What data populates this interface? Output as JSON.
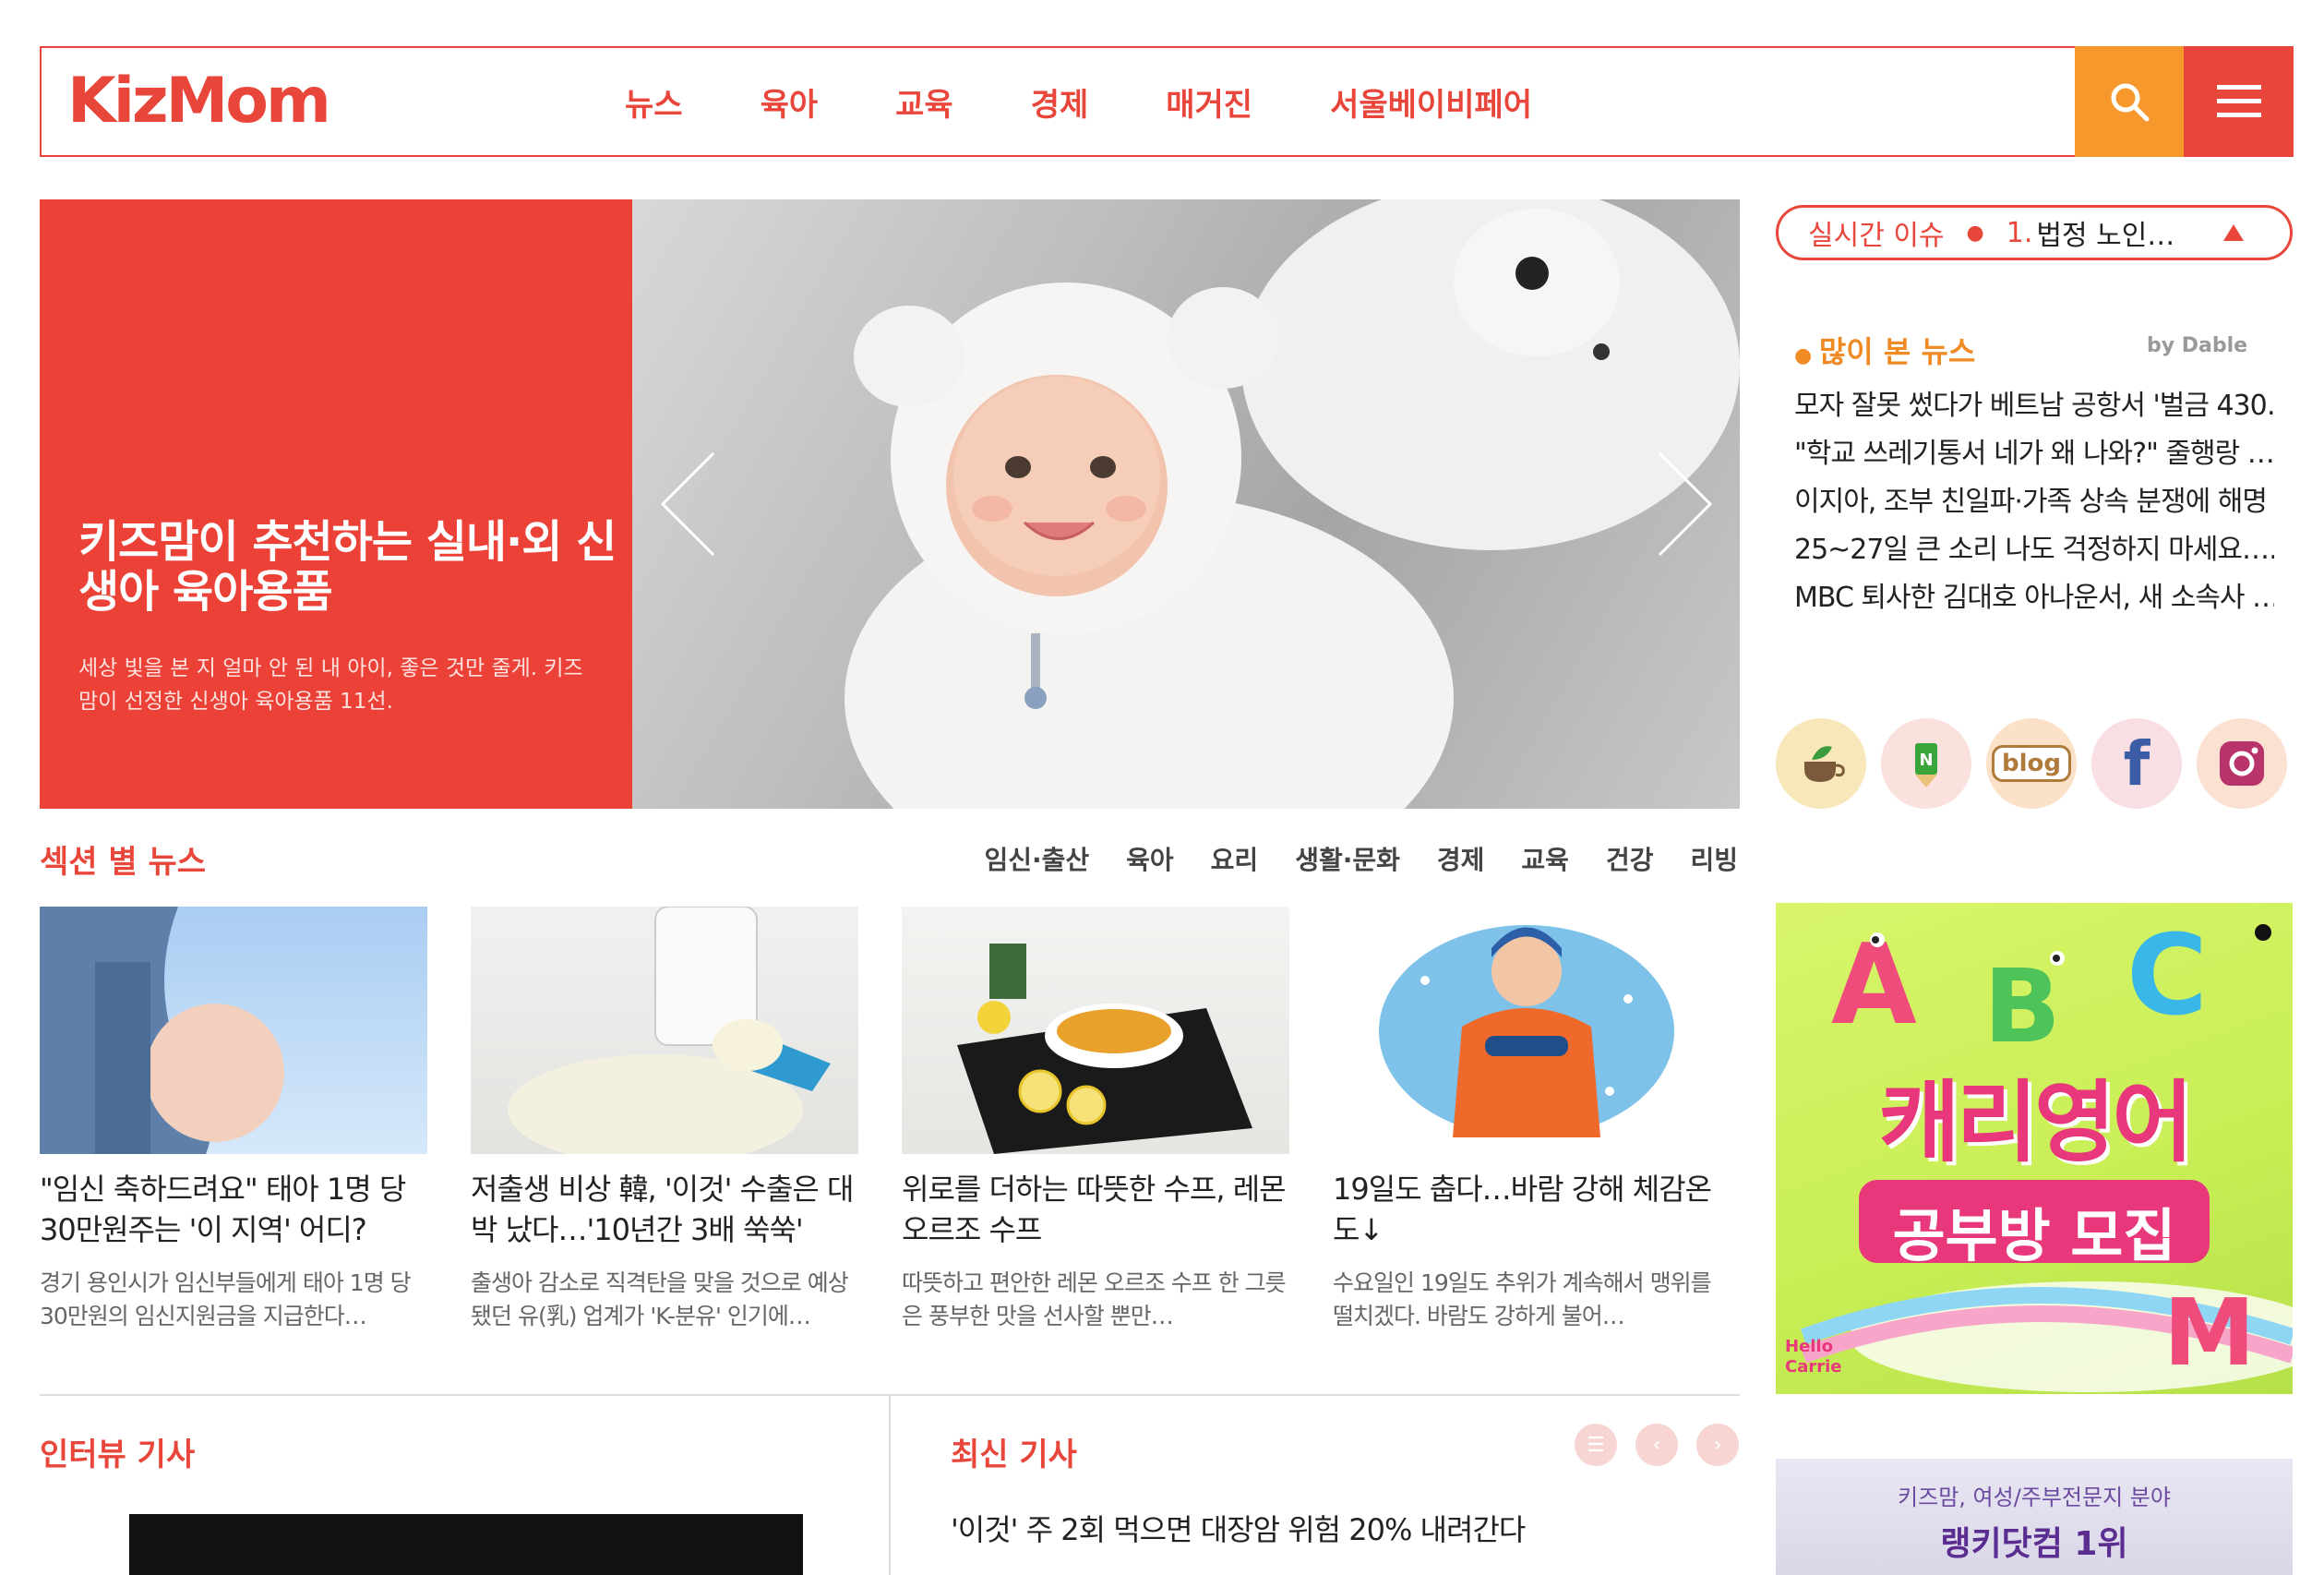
{
  "header": {
    "logo": "KizMom",
    "nav": [
      "뉴스",
      "육아",
      "교육",
      "경제",
      "매거진",
      "서울베이비페어"
    ],
    "accent_color": "#e9463b",
    "search_color": "#f6982b"
  },
  "hero": {
    "title": "키즈맘이 추천하는 실내·외 신생아 육아용품",
    "description": "세상 빛을 본 지 얼마 안 된 내 아이, 좋은 것만 줄게. 키즈맘이 선정한 신생아 육아용품 11선."
  },
  "realtime": {
    "label": "실시간 이슈",
    "rank": "1.",
    "text": "법정 노인…"
  },
  "popular": {
    "title": "많이 본 뉴스",
    "by": "by Dable",
    "items": [
      "모자 잘못 썼다가 베트남 공항서 '벌금 430…",
      "\"학교 쓰레기통서 네가 왜 나와?\" 줄행랑 …",
      "이지아, 조부 친일파·가족 상속 분쟁에 해명",
      "25~27일 큰 소리 나도 걱정하지 마세요……",
      "MBC 퇴사한 김대호 아나운서, 새 소속사 …"
    ]
  },
  "social": [
    "tea-icon",
    "naver-post-icon",
    "blog-icon",
    "facebook-icon",
    "instagram-icon"
  ],
  "social_labels": {
    "blog": "blog",
    "facebook": "f"
  },
  "ad": {
    "title": "캐리영어",
    "subtitle": "공부방 모집",
    "brand": "Hello Carrie"
  },
  "ad2": {
    "line1": "키즈맘, 여성/주부전문지 분야",
    "line2": "랭키닷컴 1위"
  },
  "section": {
    "title": "섹션 별 뉴스",
    "tabs": [
      "임신·출산",
      "육아",
      "요리",
      "생활·문화",
      "경제",
      "교육",
      "건강",
      "리빙"
    ]
  },
  "news": [
    {
      "title": "\"임신 축하드려요\" 태아 1명 당 30만원주는 '이 지역' 어디?",
      "desc": "경기 용인시가 임신부들에게 태아 1명 당 30만원의 임신지원금을 지급한다…"
    },
    {
      "title": "저출생 비상 韓, '이것' 수출은 대박 났다…'10년간 3배 쑥쑥'",
      "desc": "출생아 감소로 직격탄을 맞을 것으로 예상됐던 유(乳) 업계가 'K-분유' 인기에…"
    },
    {
      "title": "위로를 더하는 따뜻한 수프, 레몬 오르조 수프",
      "desc": "따뜻하고 편안한 레몬 오르조 수프 한 그릇은 풍부한 맛을 선사할 뿐만…"
    },
    {
      "title": "19일도 춥다…바람 강해 체감온도↓",
      "desc": "수요일인 19일도 추위가 계속해서 맹위를 떨치겠다. 바람도 강하게 불어…"
    }
  ],
  "interview": {
    "title": "인터뷰 기사"
  },
  "latest": {
    "title": "최신 기사",
    "item": "'이것' 주 2회 먹으면 대장암 위험 20% 내려간다"
  }
}
